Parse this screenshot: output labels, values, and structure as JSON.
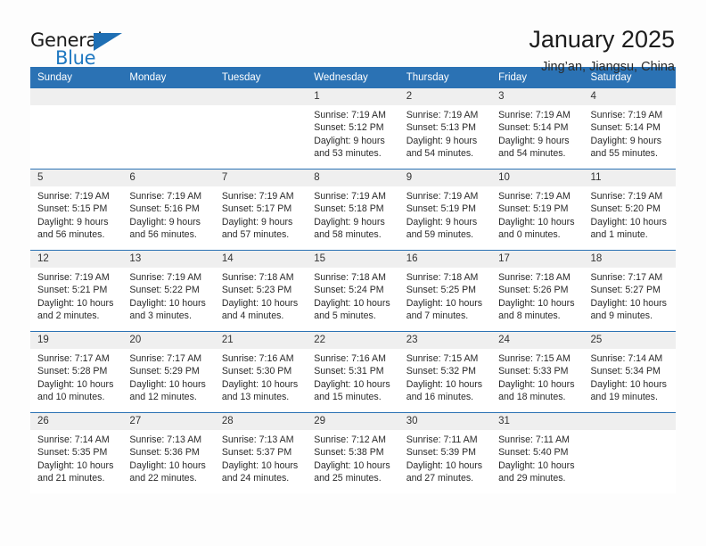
{
  "brand": {
    "word_one": "General",
    "word_two": "Blue",
    "logo_icon": "blue-triangle-icon"
  },
  "header": {
    "month_title": "January 2025",
    "location": "Jing’an, Jiangsu, China"
  },
  "calendar": {
    "weekday_headers": [
      "Sunday",
      "Monday",
      "Tuesday",
      "Wednesday",
      "Thursday",
      "Friday",
      "Saturday"
    ],
    "accent_color": "#2b72b4",
    "daynum_bg": "#efefef",
    "weeks": [
      [
        {
          "day": "",
          "empty": true
        },
        {
          "day": "",
          "empty": true
        },
        {
          "day": "",
          "empty": true
        },
        {
          "day": "1",
          "sunrise": "Sunrise: 7:19 AM",
          "sunset": "Sunset: 5:12 PM",
          "daylight_1": "Daylight: 9 hours",
          "daylight_2": "and 53 minutes."
        },
        {
          "day": "2",
          "sunrise": "Sunrise: 7:19 AM",
          "sunset": "Sunset: 5:13 PM",
          "daylight_1": "Daylight: 9 hours",
          "daylight_2": "and 54 minutes."
        },
        {
          "day": "3",
          "sunrise": "Sunrise: 7:19 AM",
          "sunset": "Sunset: 5:14 PM",
          "daylight_1": "Daylight: 9 hours",
          "daylight_2": "and 54 minutes."
        },
        {
          "day": "4",
          "sunrise": "Sunrise: 7:19 AM",
          "sunset": "Sunset: 5:14 PM",
          "daylight_1": "Daylight: 9 hours",
          "daylight_2": "and 55 minutes."
        }
      ],
      [
        {
          "day": "5",
          "sunrise": "Sunrise: 7:19 AM",
          "sunset": "Sunset: 5:15 PM",
          "daylight_1": "Daylight: 9 hours",
          "daylight_2": "and 56 minutes."
        },
        {
          "day": "6",
          "sunrise": "Sunrise: 7:19 AM",
          "sunset": "Sunset: 5:16 PM",
          "daylight_1": "Daylight: 9 hours",
          "daylight_2": "and 56 minutes."
        },
        {
          "day": "7",
          "sunrise": "Sunrise: 7:19 AM",
          "sunset": "Sunset: 5:17 PM",
          "daylight_1": "Daylight: 9 hours",
          "daylight_2": "and 57 minutes."
        },
        {
          "day": "8",
          "sunrise": "Sunrise: 7:19 AM",
          "sunset": "Sunset: 5:18 PM",
          "daylight_1": "Daylight: 9 hours",
          "daylight_2": "and 58 minutes."
        },
        {
          "day": "9",
          "sunrise": "Sunrise: 7:19 AM",
          "sunset": "Sunset: 5:19 PM",
          "daylight_1": "Daylight: 9 hours",
          "daylight_2": "and 59 minutes."
        },
        {
          "day": "10",
          "sunrise": "Sunrise: 7:19 AM",
          "sunset": "Sunset: 5:19 PM",
          "daylight_1": "Daylight: 10 hours",
          "daylight_2": "and 0 minutes."
        },
        {
          "day": "11",
          "sunrise": "Sunrise: 7:19 AM",
          "sunset": "Sunset: 5:20 PM",
          "daylight_1": "Daylight: 10 hours",
          "daylight_2": "and 1 minute."
        }
      ],
      [
        {
          "day": "12",
          "sunrise": "Sunrise: 7:19 AM",
          "sunset": "Sunset: 5:21 PM",
          "daylight_1": "Daylight: 10 hours",
          "daylight_2": "and 2 minutes."
        },
        {
          "day": "13",
          "sunrise": "Sunrise: 7:19 AM",
          "sunset": "Sunset: 5:22 PM",
          "daylight_1": "Daylight: 10 hours",
          "daylight_2": "and 3 minutes."
        },
        {
          "day": "14",
          "sunrise": "Sunrise: 7:18 AM",
          "sunset": "Sunset: 5:23 PM",
          "daylight_1": "Daylight: 10 hours",
          "daylight_2": "and 4 minutes."
        },
        {
          "day": "15",
          "sunrise": "Sunrise: 7:18 AM",
          "sunset": "Sunset: 5:24 PM",
          "daylight_1": "Daylight: 10 hours",
          "daylight_2": "and 5 minutes."
        },
        {
          "day": "16",
          "sunrise": "Sunrise: 7:18 AM",
          "sunset": "Sunset: 5:25 PM",
          "daylight_1": "Daylight: 10 hours",
          "daylight_2": "and 7 minutes."
        },
        {
          "day": "17",
          "sunrise": "Sunrise: 7:18 AM",
          "sunset": "Sunset: 5:26 PM",
          "daylight_1": "Daylight: 10 hours",
          "daylight_2": "and 8 minutes."
        },
        {
          "day": "18",
          "sunrise": "Sunrise: 7:17 AM",
          "sunset": "Sunset: 5:27 PM",
          "daylight_1": "Daylight: 10 hours",
          "daylight_2": "and 9 minutes."
        }
      ],
      [
        {
          "day": "19",
          "sunrise": "Sunrise: 7:17 AM",
          "sunset": "Sunset: 5:28 PM",
          "daylight_1": "Daylight: 10 hours",
          "daylight_2": "and 10 minutes."
        },
        {
          "day": "20",
          "sunrise": "Sunrise: 7:17 AM",
          "sunset": "Sunset: 5:29 PM",
          "daylight_1": "Daylight: 10 hours",
          "daylight_2": "and 12 minutes."
        },
        {
          "day": "21",
          "sunrise": "Sunrise: 7:16 AM",
          "sunset": "Sunset: 5:30 PM",
          "daylight_1": "Daylight: 10 hours",
          "daylight_2": "and 13 minutes."
        },
        {
          "day": "22",
          "sunrise": "Sunrise: 7:16 AM",
          "sunset": "Sunset: 5:31 PM",
          "daylight_1": "Daylight: 10 hours",
          "daylight_2": "and 15 minutes."
        },
        {
          "day": "23",
          "sunrise": "Sunrise: 7:15 AM",
          "sunset": "Sunset: 5:32 PM",
          "daylight_1": "Daylight: 10 hours",
          "daylight_2": "and 16 minutes."
        },
        {
          "day": "24",
          "sunrise": "Sunrise: 7:15 AM",
          "sunset": "Sunset: 5:33 PM",
          "daylight_1": "Daylight: 10 hours",
          "daylight_2": "and 18 minutes."
        },
        {
          "day": "25",
          "sunrise": "Sunrise: 7:14 AM",
          "sunset": "Sunset: 5:34 PM",
          "daylight_1": "Daylight: 10 hours",
          "daylight_2": "and 19 minutes."
        }
      ],
      [
        {
          "day": "26",
          "sunrise": "Sunrise: 7:14 AM",
          "sunset": "Sunset: 5:35 PM",
          "daylight_1": "Daylight: 10 hours",
          "daylight_2": "and 21 minutes."
        },
        {
          "day": "27",
          "sunrise": "Sunrise: 7:13 AM",
          "sunset": "Sunset: 5:36 PM",
          "daylight_1": "Daylight: 10 hours",
          "daylight_2": "and 22 minutes."
        },
        {
          "day": "28",
          "sunrise": "Sunrise: 7:13 AM",
          "sunset": "Sunset: 5:37 PM",
          "daylight_1": "Daylight: 10 hours",
          "daylight_2": "and 24 minutes."
        },
        {
          "day": "29",
          "sunrise": "Sunrise: 7:12 AM",
          "sunset": "Sunset: 5:38 PM",
          "daylight_1": "Daylight: 10 hours",
          "daylight_2": "and 25 minutes."
        },
        {
          "day": "30",
          "sunrise": "Sunrise: 7:11 AM",
          "sunset": "Sunset: 5:39 PM",
          "daylight_1": "Daylight: 10 hours",
          "daylight_2": "and 27 minutes."
        },
        {
          "day": "31",
          "sunrise": "Sunrise: 7:11 AM",
          "sunset": "Sunset: 5:40 PM",
          "daylight_1": "Daylight: 10 hours",
          "daylight_2": "and 29 minutes."
        },
        {
          "day": "",
          "empty": true
        }
      ]
    ]
  }
}
